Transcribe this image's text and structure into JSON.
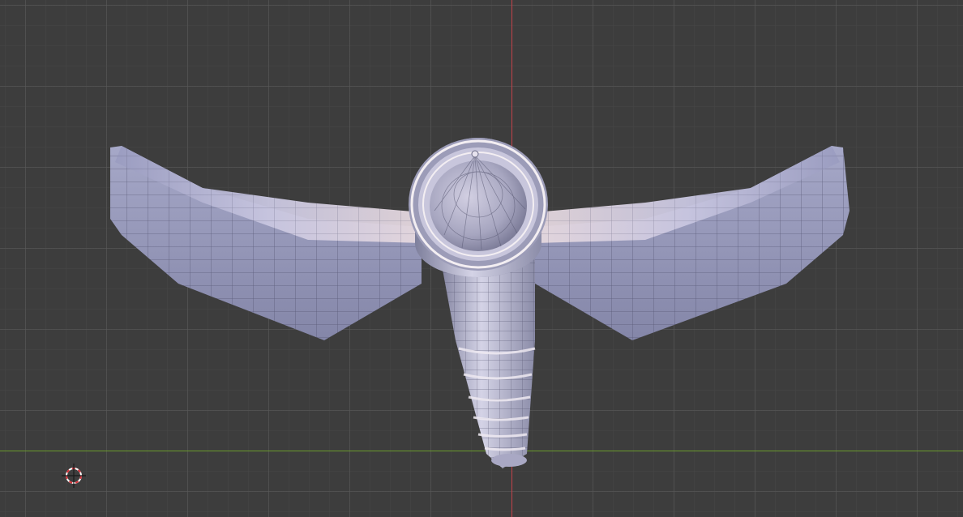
{
  "viewport": {
    "mode": "object",
    "object": "axe-model",
    "shading": "solid",
    "wireframe_overlay": true,
    "colors": {
      "background": "#3d3d3d",
      "grid": "#555555",
      "axis_x": "#6a9a2c",
      "axis_y": "#c3424a",
      "mesh_light": "#d8d6ea",
      "mesh_mid": "#9a9ab8",
      "mesh_dark": "#5c5c7a"
    }
  }
}
